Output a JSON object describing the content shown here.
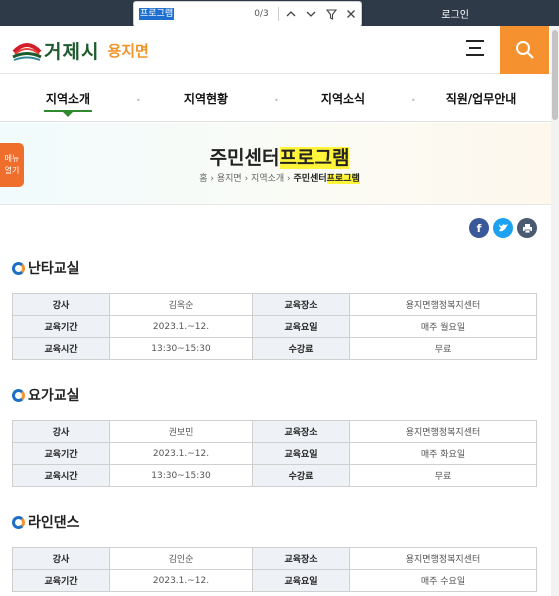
{
  "topbar": {
    "login": "로그인"
  },
  "findbar": {
    "query": "프로그램",
    "count": "0/3"
  },
  "header": {
    "city": "거제시",
    "town": "용지면"
  },
  "nav": {
    "items": [
      "지역소개",
      "지역현황",
      "지역소식",
      "직원/업무안내"
    ]
  },
  "banner": {
    "title_prefix": "주민센터",
    "title_highlight": "프로그램",
    "side_tab": "메뉴 열기",
    "breadcrumb": {
      "home": "홈",
      "b1": "용지면",
      "b2": "지역소개",
      "current_prefix": "주민센터",
      "current_highlight": "프로그램"
    }
  },
  "colors": {
    "accent": "#f5922f",
    "nav_active": "#2f8a2f",
    "facebook": "#3b5998",
    "twitter": "#1da1f2",
    "print": "#4a5a70",
    "find_highlight": "#fff43a"
  },
  "share": {
    "icons": [
      "facebook-icon",
      "twitter-icon",
      "print-icon"
    ]
  },
  "sections": [
    {
      "title": "난타교실",
      "rows": [
        [
          "강사",
          "김옥순",
          "교육장소",
          "용지면행정복지센터"
        ],
        [
          "교육기간",
          "2023.1.~12.",
          "교육요일",
          "매주 월요일"
        ],
        [
          "교육시간",
          "13:30~15:30",
          "수강료",
          "무료"
        ]
      ]
    },
    {
      "title": "요가교실",
      "rows": [
        [
          "강사",
          "권보민",
          "교육장소",
          "용지면행정복지센터"
        ],
        [
          "교육기간",
          "2023.1.~12.",
          "교육요일",
          "매주 화요일"
        ],
        [
          "교육시간",
          "13:30~15:30",
          "수강료",
          "무료"
        ]
      ]
    },
    {
      "title": "라인댄스",
      "rows": [
        [
          "강사",
          "김인순",
          "교육장소",
          "용지면행정복지센터"
        ],
        [
          "교육기간",
          "2023.1.~12.",
          "교육요일",
          "매주 수요일"
        ]
      ]
    }
  ]
}
